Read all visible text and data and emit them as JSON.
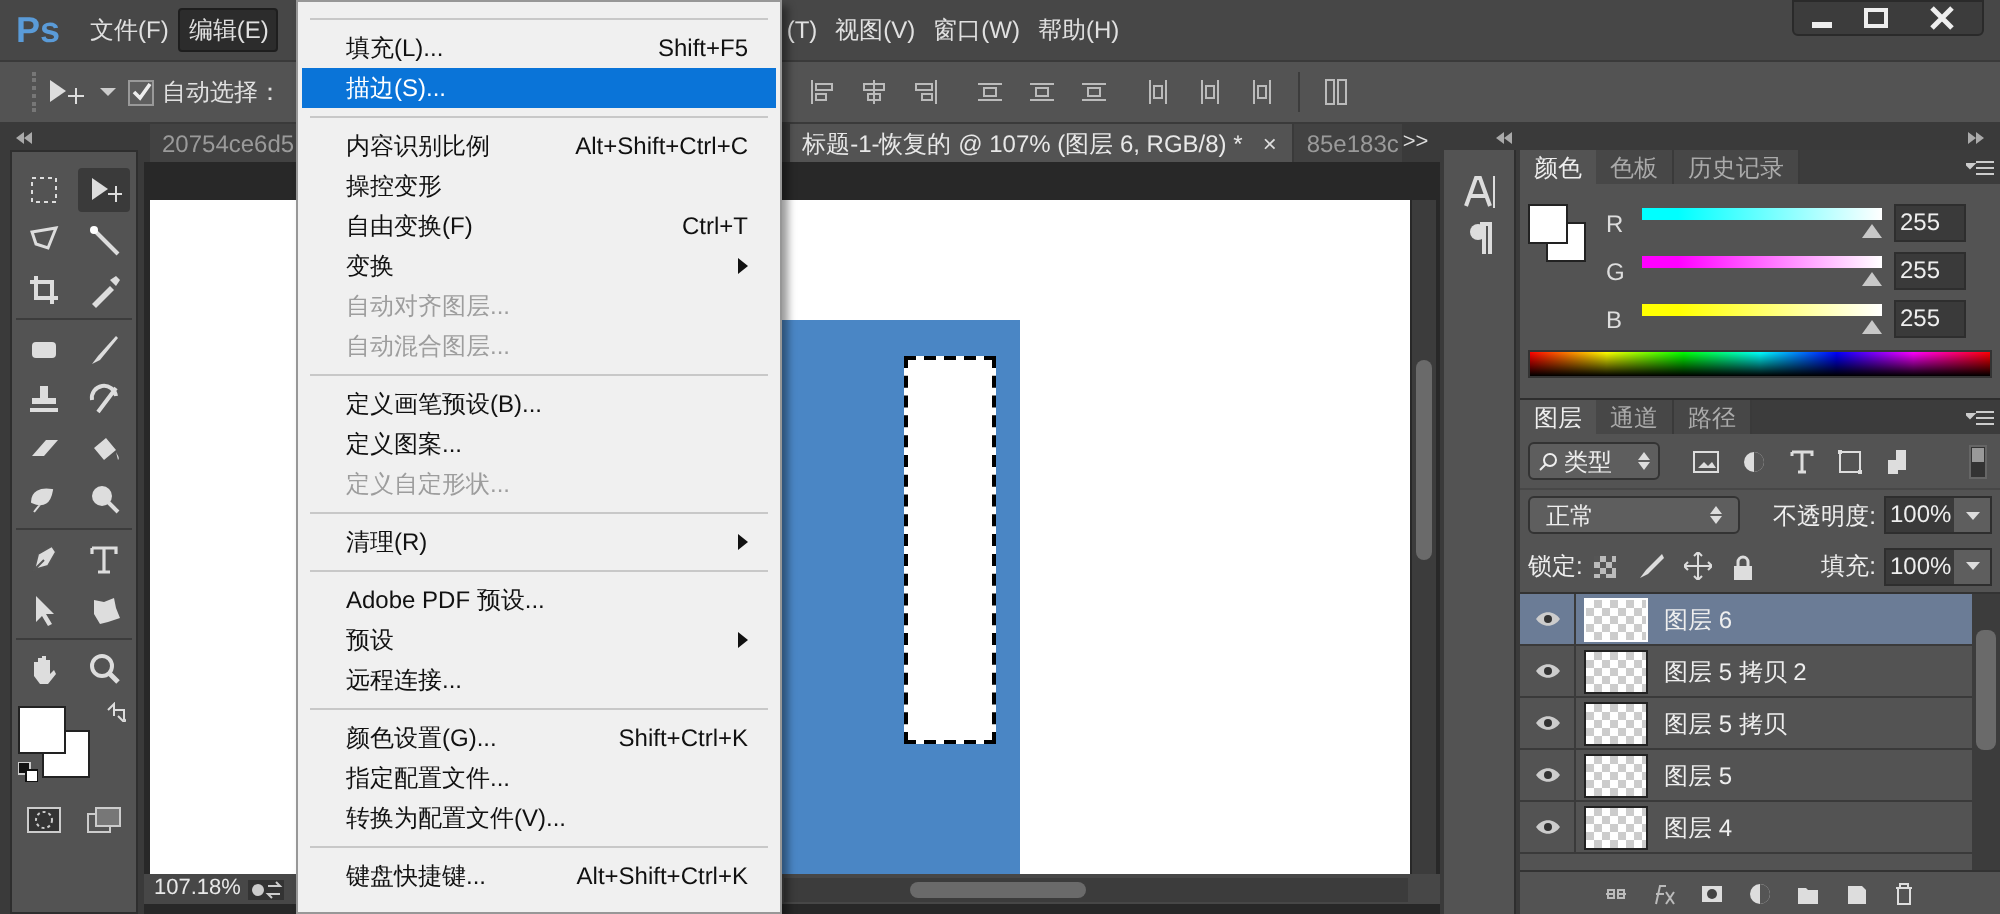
{
  "menubar": {
    "logo": "Ps",
    "items": [
      {
        "label": "文件(F)",
        "selected": false
      },
      {
        "label": "编辑(E)",
        "selected": true
      },
      {
        "label": "(T)",
        "selected": false
      },
      {
        "label": "视图(V)",
        "selected": false
      },
      {
        "label": "窗口(W)",
        "selected": false
      },
      {
        "label": "帮助(H)",
        "selected": false
      }
    ]
  },
  "options_bar": {
    "auto_select": {
      "label": "自动选择：",
      "checked": true
    }
  },
  "doc_tabs": [
    {
      "title": "20754ce6d5",
      "selected": false
    },
    {
      "title": "标题-1-恢复的 @ 107% (图层 6, RGB/8) *",
      "selected": true,
      "close": "×"
    },
    {
      "title": "85e183c",
      "selected": false
    }
  ],
  "doc_tabs_more": ">>",
  "status_bar": {
    "zoom": "107.18%"
  },
  "edit_menu": [
    {
      "kind": "separator"
    },
    {
      "kind": "item",
      "label": "填充(L)...",
      "shortcut": "Shift+F5",
      "disabled": false,
      "submenu": false,
      "selected": false
    },
    {
      "kind": "item",
      "label": "描边(S)...",
      "disabled": false,
      "submenu": false,
      "selected": true
    },
    {
      "kind": "separator"
    },
    {
      "kind": "item",
      "label": "内容识别比例",
      "shortcut": "Alt+Shift+Ctrl+C",
      "disabled": false,
      "submenu": false,
      "selected": false
    },
    {
      "kind": "item",
      "label": "操控变形",
      "disabled": false,
      "submenu": false,
      "selected": false
    },
    {
      "kind": "item",
      "label": "自由变换(F)",
      "shortcut": "Ctrl+T",
      "disabled": false,
      "submenu": false,
      "selected": false
    },
    {
      "kind": "item",
      "label": "变换",
      "disabled": false,
      "submenu": true,
      "selected": false
    },
    {
      "kind": "item",
      "label": "自动对齐图层...",
      "disabled": true,
      "submenu": false,
      "selected": false
    },
    {
      "kind": "item",
      "label": "自动混合图层...",
      "disabled": true,
      "submenu": false,
      "selected": false
    },
    {
      "kind": "separator"
    },
    {
      "kind": "item",
      "label": "定义画笔预设(B)...",
      "disabled": false,
      "submenu": false,
      "selected": false
    },
    {
      "kind": "item",
      "label": "定义图案...",
      "disabled": false,
      "submenu": false,
      "selected": false
    },
    {
      "kind": "item",
      "label": "定义自定形状...",
      "disabled": true,
      "submenu": false,
      "selected": false
    },
    {
      "kind": "separator"
    },
    {
      "kind": "item",
      "label": "清理(R)",
      "disabled": false,
      "submenu": true,
      "selected": false
    },
    {
      "kind": "separator"
    },
    {
      "kind": "item",
      "label": "Adobe PDF 预设...",
      "disabled": false,
      "submenu": false,
      "selected": false
    },
    {
      "kind": "item",
      "label": "预设",
      "disabled": false,
      "submenu": true,
      "selected": false
    },
    {
      "kind": "item",
      "label": "远程连接...",
      "disabled": false,
      "submenu": false,
      "selected": false
    },
    {
      "kind": "separator"
    },
    {
      "kind": "item",
      "label": "颜色设置(G)...",
      "shortcut": "Shift+Ctrl+K",
      "disabled": false,
      "submenu": false,
      "selected": false
    },
    {
      "kind": "item",
      "label": "指定配置文件...",
      "disabled": false,
      "submenu": false,
      "selected": false
    },
    {
      "kind": "item",
      "label": "转换为配置文件(V)...",
      "disabled": false,
      "submenu": false,
      "selected": false
    },
    {
      "kind": "separator"
    },
    {
      "kind": "item",
      "label": "键盘快捷键...",
      "shortcut": "Alt+Shift+Ctrl+K",
      "disabled": false,
      "submenu": false,
      "selected": false
    }
  ],
  "color_panel": {
    "tabs": [
      {
        "label": "颜色",
        "selected": true
      },
      {
        "label": "色板",
        "selected": false
      },
      {
        "label": "历史记录",
        "selected": false
      }
    ],
    "channels": [
      {
        "name": "R",
        "color": "#00ffff",
        "level": 1,
        "value": "255"
      },
      {
        "name": "G",
        "color": "#ff00ff",
        "level": 1,
        "value": "255"
      },
      {
        "name": "B",
        "color": "#ffff00",
        "level": 1,
        "value": "255"
      }
    ]
  },
  "layers_panel": {
    "tabs": [
      {
        "label": "图层",
        "selected": true
      },
      {
        "label": "通道",
        "selected": false
      },
      {
        "label": "路径",
        "selected": false
      }
    ],
    "filter": "类型",
    "blend_mode": "正常",
    "opacity_label": "不透明度:",
    "opacity": "100%",
    "lock_label": "锁定:",
    "fill_label": "填充:",
    "fill": "100%",
    "layers": [
      {
        "name": "图层 6",
        "visible": true,
        "selected": true
      },
      {
        "name": "图层 5 拷贝 2",
        "visible": true,
        "selected": false
      },
      {
        "name": "图层 5 拷贝",
        "visible": true,
        "selected": false
      },
      {
        "name": "图层 5",
        "visible": true,
        "selected": false
      },
      {
        "name": "图层 4",
        "visible": true,
        "selected": false
      }
    ]
  }
}
